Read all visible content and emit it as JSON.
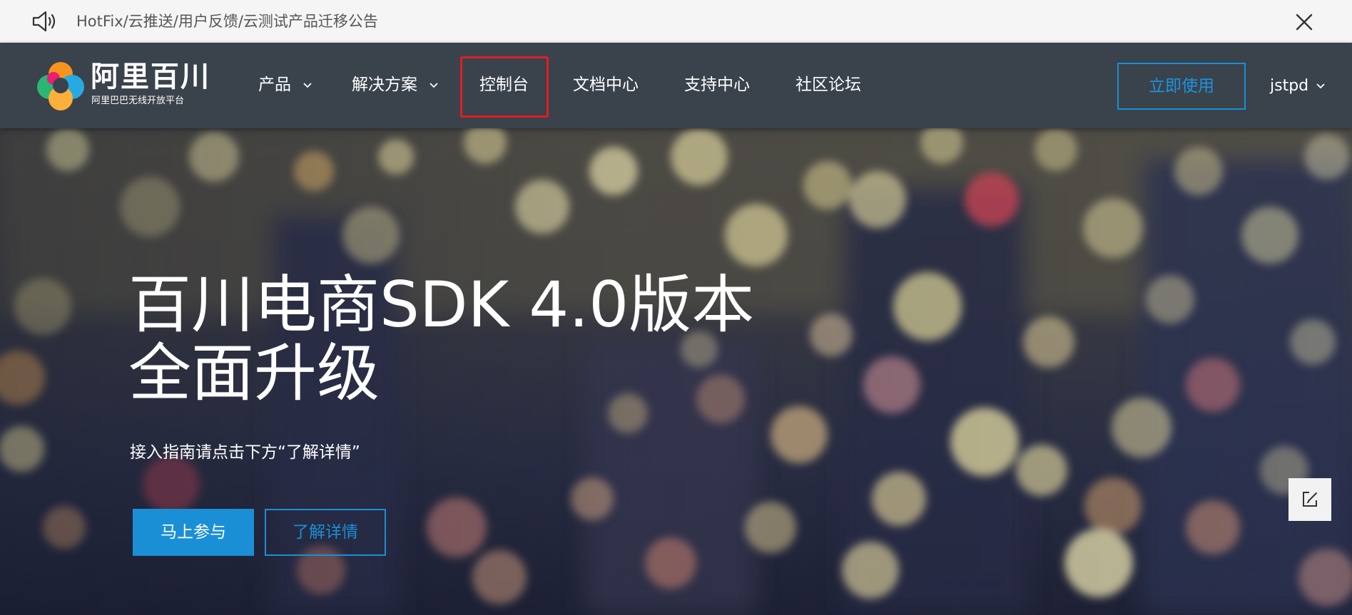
{
  "announcement": {
    "speaker_icon": "speaker-icon",
    "text": "HotFix/云推送/用户反馈/云测试产品迁移公告",
    "close_icon": "close-icon"
  },
  "nav": {
    "logo": {
      "name": "阿里百川",
      "subtitle": "阿里巴巴无线开放平台"
    },
    "menu": [
      {
        "label": "产品",
        "has_dropdown": true
      },
      {
        "label": "解决方案",
        "has_dropdown": true
      },
      {
        "label": "控制台",
        "has_dropdown": false,
        "highlighted": true
      },
      {
        "label": "文档中心",
        "has_dropdown": false
      },
      {
        "label": "支持中心",
        "has_dropdown": false
      },
      {
        "label": "社区论坛",
        "has_dropdown": false
      }
    ],
    "cta_label": "立即使用",
    "user_label": "jstpd"
  },
  "hero": {
    "title_line1": "百川电商SDK 4.0版本",
    "title_line2": "全面升级",
    "subtitle": "接入指南请点击下方“了解详情”",
    "primary_button": "马上参与",
    "secondary_button": "了解详情"
  },
  "feedback_icon": "edit-feedback-icon",
  "colors": {
    "nav_bg": "#3a424c",
    "accent_blue": "#1a8fd6",
    "highlight_red": "#e51c23",
    "notice_bg": "#f5f5f5"
  }
}
